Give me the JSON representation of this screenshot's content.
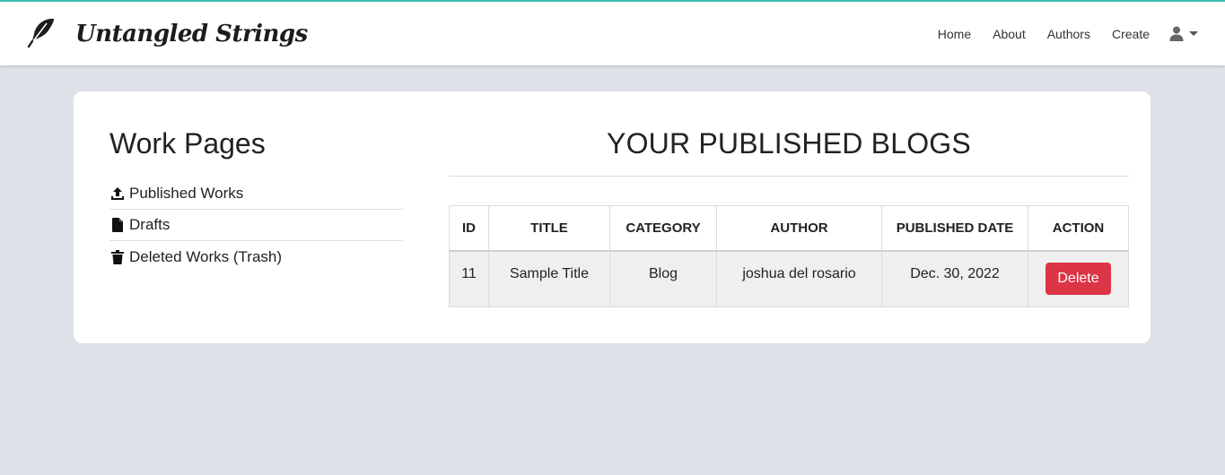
{
  "brand": {
    "name": "Untangled Strings",
    "logo_icon": "feather-icon"
  },
  "nav": {
    "links": [
      "Home",
      "About",
      "Authors",
      "Create"
    ],
    "user_icon": "user-icon"
  },
  "sidebar": {
    "title": "Work Pages",
    "items": [
      {
        "label": "Published Works",
        "icon": "upload-icon"
      },
      {
        "label": "Drafts",
        "icon": "file-icon"
      },
      {
        "label": "Deleted Works (Trash)",
        "icon": "trash-icon"
      }
    ]
  },
  "main": {
    "title": "YOUR PUBLISHED BLOGS",
    "table": {
      "headers": [
        "ID",
        "TITLE",
        "CATEGORY",
        "AUTHOR",
        "PUBLISHED DATE",
        "ACTION"
      ],
      "rows": [
        {
          "id": "11",
          "title": "Sample Title",
          "category": "Blog",
          "author": "joshua del rosario",
          "date": "Dec. 30, 2022",
          "action": "Delete"
        }
      ]
    }
  },
  "colors": {
    "accent_line": "#3fc1b0",
    "danger": "#dc3545",
    "page_bg": "#dee1e8"
  }
}
